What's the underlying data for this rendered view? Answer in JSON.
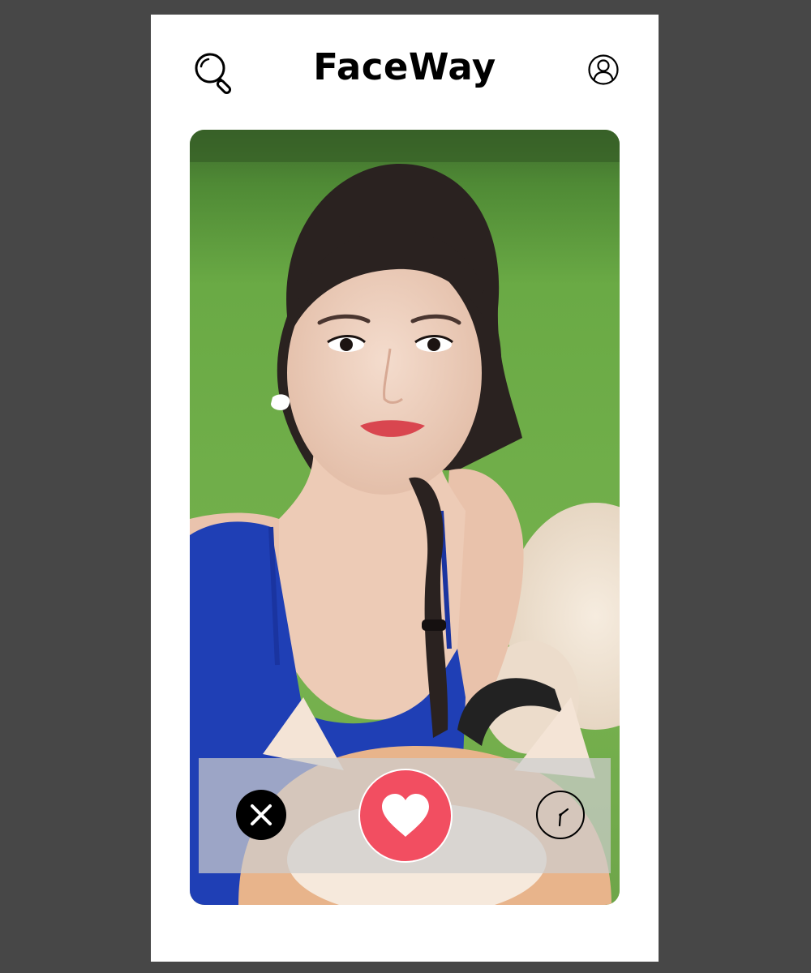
{
  "app": {
    "title": "FaceWay"
  },
  "header": {
    "left_icon": "search-icon",
    "right_icon": "user-profile-icon"
  },
  "card": {
    "photo_subject": "profile-photo",
    "actions": [
      {
        "icon": "close-icon",
        "color": "#000000"
      },
      {
        "icon": "heart-icon",
        "color": "#f24e61"
      },
      {
        "icon": "clock-icon",
        "color": "#000000"
      }
    ]
  },
  "colors": {
    "background": "#474747",
    "screen": "#ffffff",
    "like": "#f24e61",
    "action_bar": "#cdcdcd"
  }
}
